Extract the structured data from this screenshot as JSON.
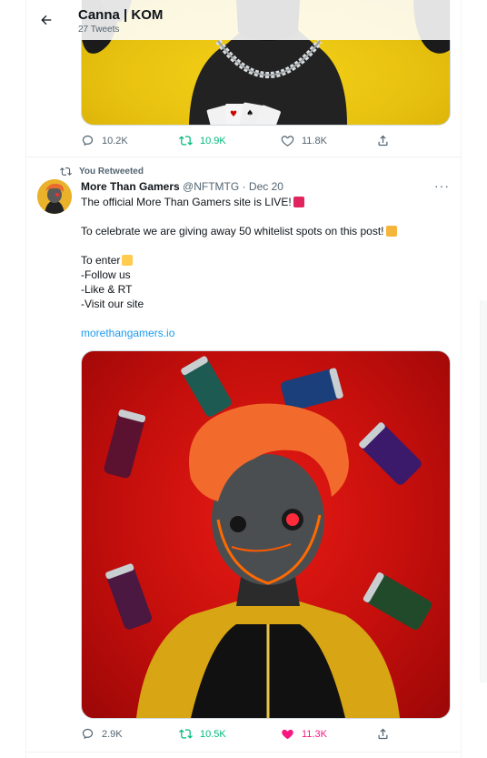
{
  "header": {
    "title": "Canna | KOM",
    "subtitle": "27 Tweets",
    "back_icon": "arrow-left-icon"
  },
  "tweet1": {
    "stats": {
      "replies": "10.2K",
      "retweets": "10.9K",
      "likes": "11.8K"
    }
  },
  "tweet2": {
    "retweeted_label": "You Retweeted",
    "author_name": "More Than Gamers",
    "author_handle": "@NFTMTG",
    "date_sep": "·",
    "date": "Dec 20",
    "more": "···",
    "lines": [
      "The official More Than Gamers site is LIVE!",
      "To celebrate we are giving away 50 whitelist spots on this post!",
      "To enter",
      "-Follow us",
      "-Like & RT",
      "-Visit our site"
    ],
    "link": "morethangamers.io",
    "stats": {
      "replies": "2.9K",
      "retweets": "10.5K",
      "likes": "11.3K"
    }
  },
  "colors": {
    "retweet": "#00ba7c",
    "like": "#f91880",
    "link": "#1d9bf0",
    "muted": "#536471"
  }
}
